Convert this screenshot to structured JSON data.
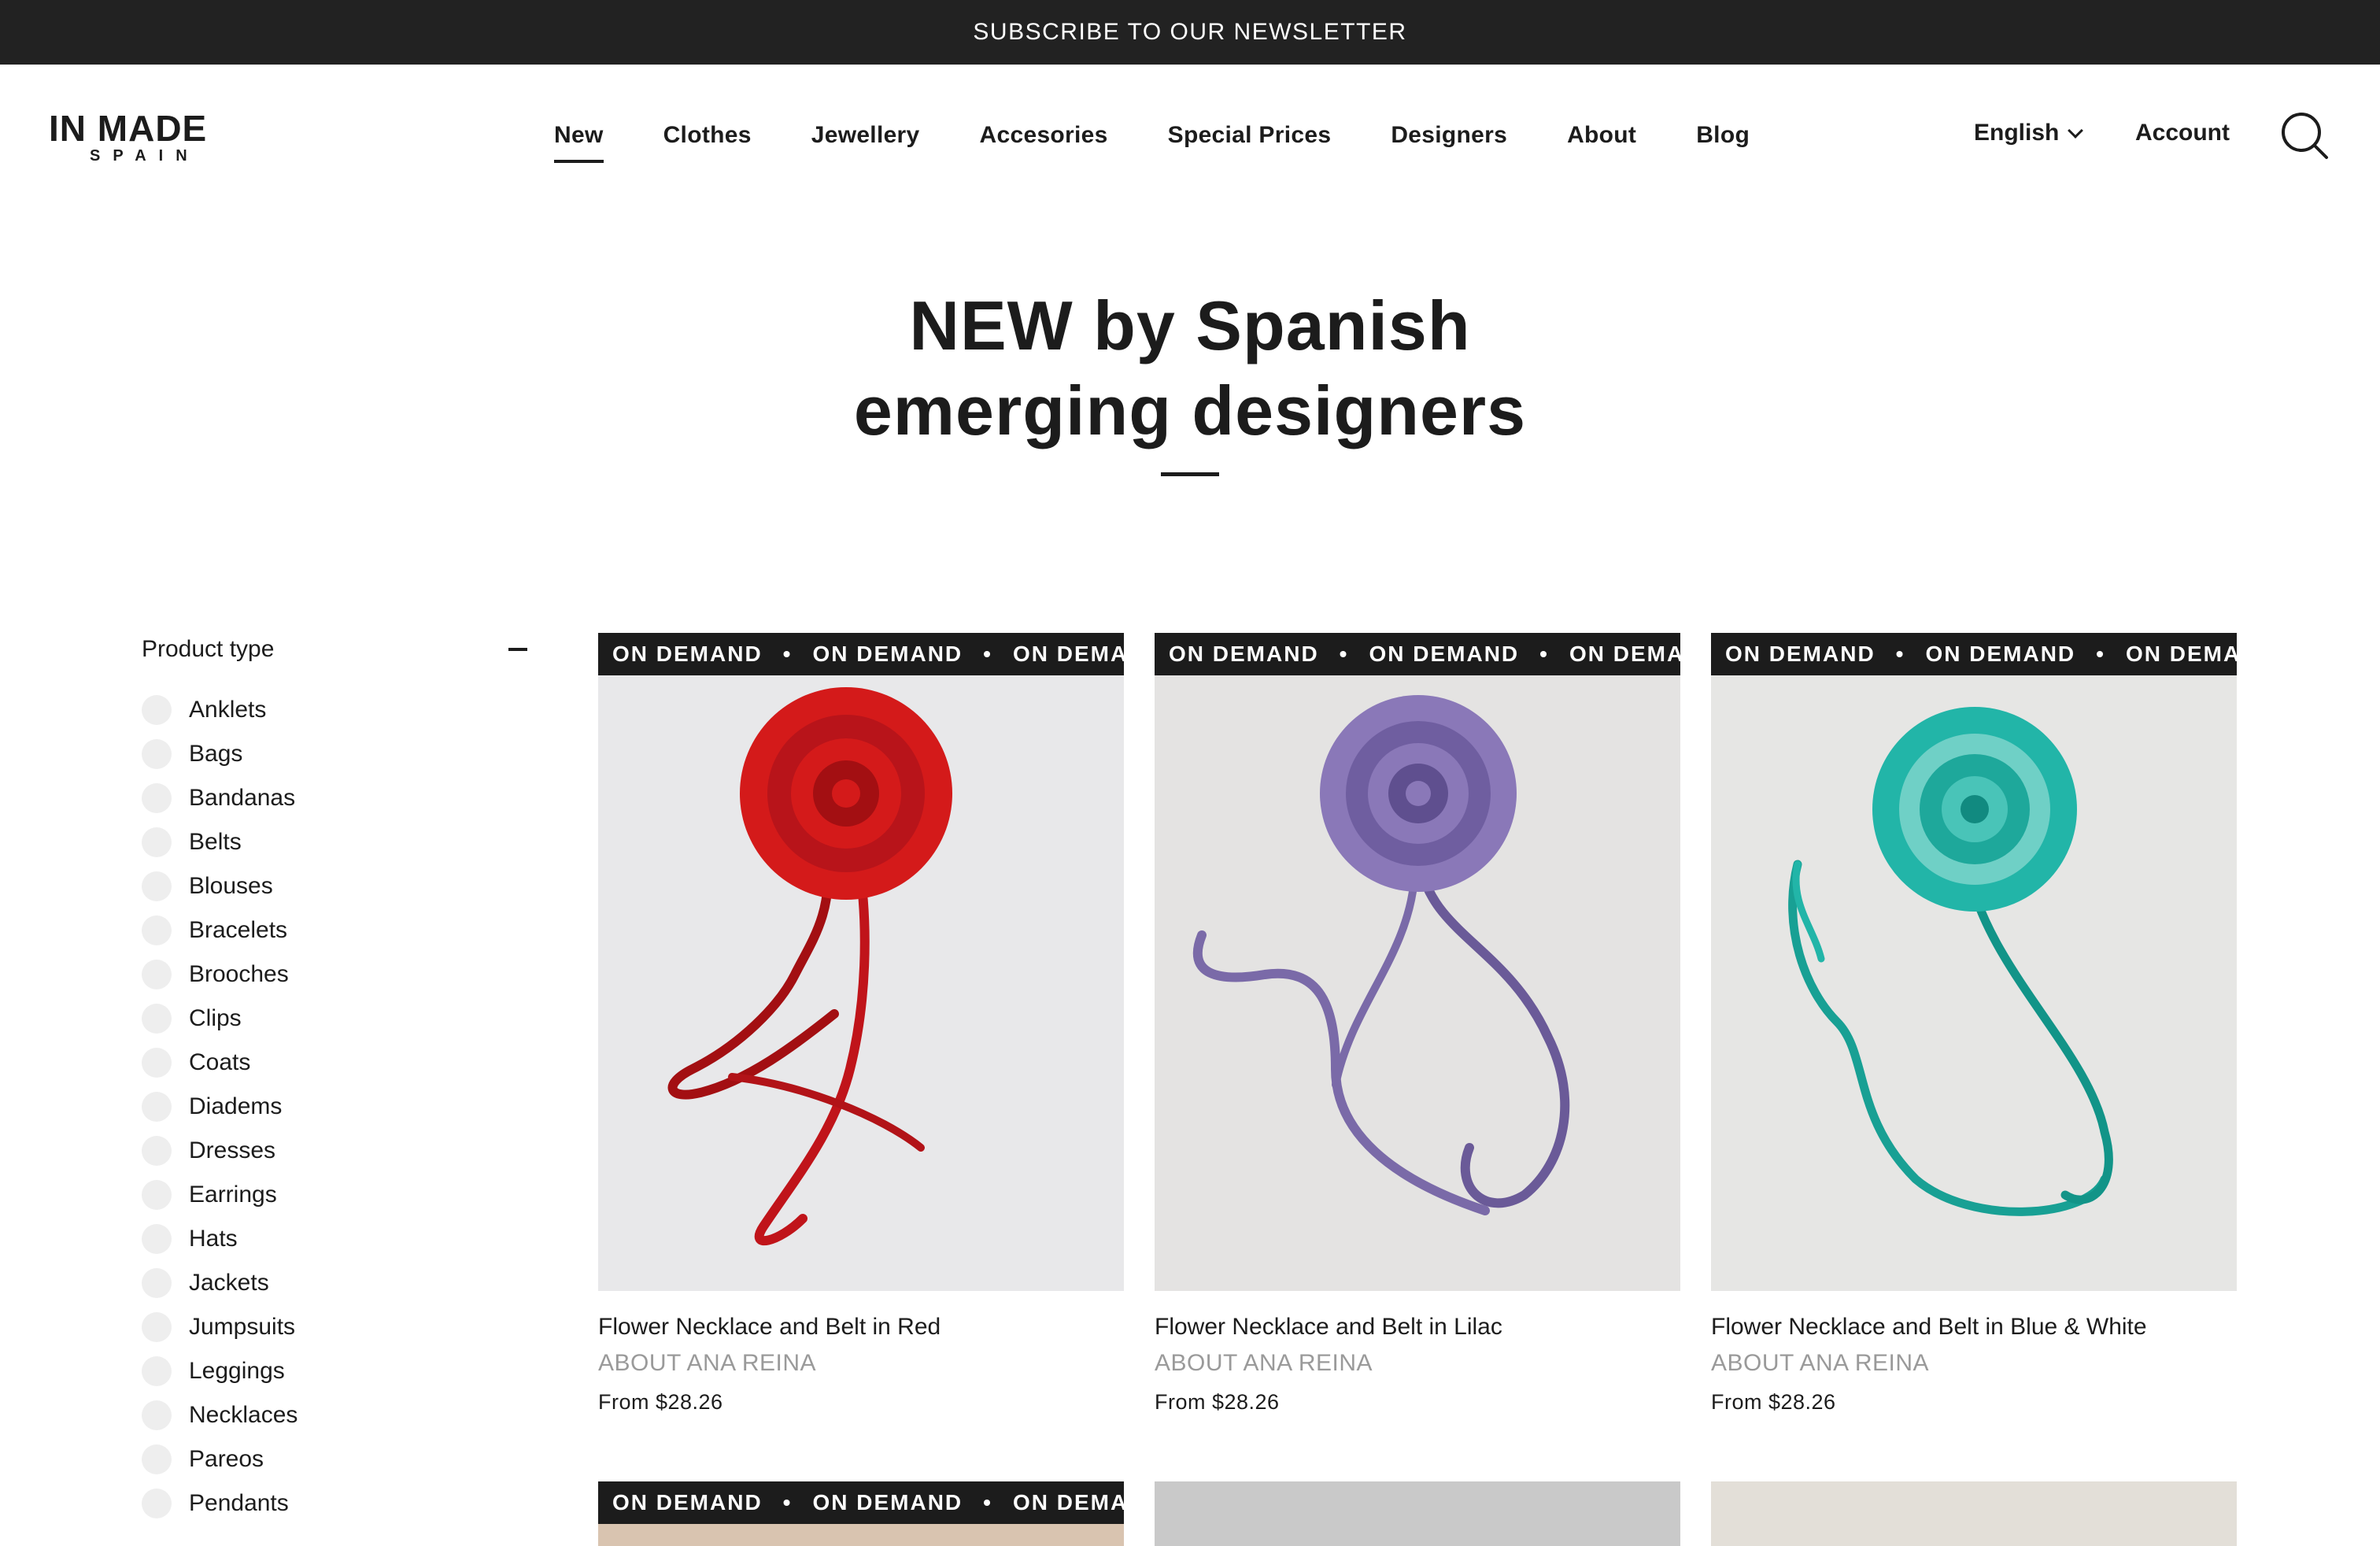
{
  "announcement": "SUBSCRIBE TO OUR NEWSLETTER",
  "logo": {
    "line1": "IN MADE",
    "line2": "SPAIN"
  },
  "nav": [
    {
      "label": "New",
      "active": true
    },
    {
      "label": "Clothes"
    },
    {
      "label": "Jewellery"
    },
    {
      "label": "Accesories"
    },
    {
      "label": "Special Prices"
    },
    {
      "label": "Designers"
    },
    {
      "label": "About"
    },
    {
      "label": "Blog"
    }
  ],
  "language": "English",
  "account": "Account",
  "hero": {
    "line1": "NEW by Spanish",
    "line2": "emerging designers"
  },
  "filter": {
    "title": "Product type",
    "items": [
      "Anklets",
      "Bags",
      "Bandanas",
      "Belts",
      "Blouses",
      "Bracelets",
      "Brooches",
      "Clips",
      "Coats",
      "Diadems",
      "Dresses",
      "Earrings",
      "Hats",
      "Jackets",
      "Jumpsuits",
      "Leggings",
      "Necklaces",
      "Pareos",
      "Pendants"
    ]
  },
  "badge_text": "ON DEMAND",
  "products": [
    {
      "name": "Flower Necklace and Belt in Red",
      "designer": "ABOUT ANA REINA",
      "price": "From $28.26",
      "color": "#d41a1a",
      "dark": "#a30f12"
    },
    {
      "name": "Flower Necklace and Belt in Lilac",
      "designer": "ABOUT ANA REINA",
      "price": "From $28.26",
      "color": "#8a78b8",
      "dark": "#5f4f8f"
    },
    {
      "name": "Flower Necklace and Belt in Blue & White",
      "designer": "ABOUT ANA REINA",
      "price": "From $28.26",
      "color": "#22b5a8",
      "dark": "#118a80"
    }
  ],
  "colors": {
    "announce_bg": "#222222",
    "text": "#1c1c1c",
    "muted": "#9a9a9a",
    "radio": "#eeeeee"
  }
}
